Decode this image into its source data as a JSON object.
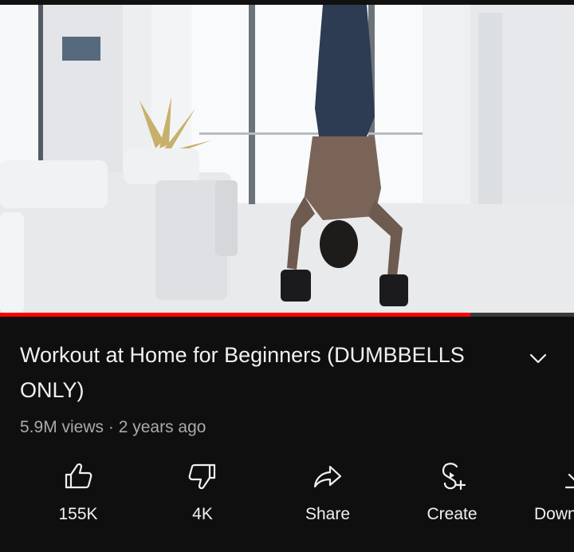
{
  "video": {
    "title": "Workout at Home for Beginners (DUMBBELLS ONLY)",
    "views": "5.9M views",
    "separator": "·",
    "age": "2 years ago",
    "progress_fraction": 0.82
  },
  "actions": {
    "like": {
      "label": "155K",
      "icon": "thumbs-up-icon"
    },
    "dislike": {
      "label": "4K",
      "icon": "thumbs-down-icon"
    },
    "share": {
      "label": "Share",
      "icon": "share-arrow-icon"
    },
    "create": {
      "label": "Create",
      "icon": "create-sparkle-icon"
    },
    "download": {
      "label": "Down",
      "icon": "download-icon"
    }
  },
  "colors": {
    "background": "#0f0f0f",
    "progress": "#ff0000",
    "text": "#f1f1f1",
    "meta": "#aaaaaa"
  }
}
